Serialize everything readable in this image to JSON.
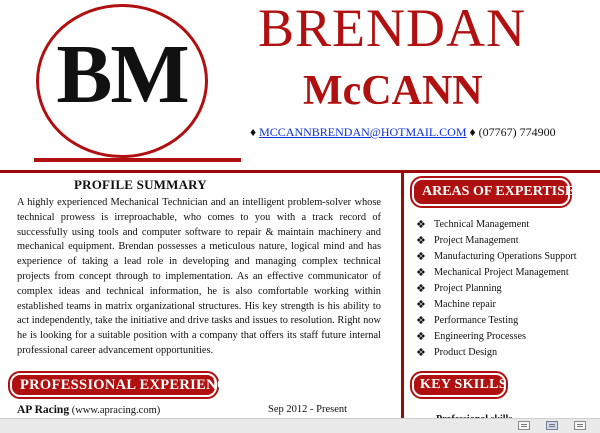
{
  "header": {
    "monogram": "BM",
    "first_name": "BRENDAN",
    "last_name": "McCANN",
    "contact": {
      "bullet": "♦",
      "email": "MCCANNBRENDAN@HOTMAIL.COM",
      "phone": "(07767) 774900"
    }
  },
  "profile": {
    "title": "PROFILE SUMMARY",
    "text": "A highly experienced Mechanical Technician and an intelligent problem-solver whose technical prowess is irreproachable, who comes to you with a track record of successfully using tools and computer software to repair & maintain machinery and mechanical equipment. Brendan possesses a meticulous nature, logical mind and has experience of taking a lead role in developing and managing complex technical projects from concept through to implementation. As an effective communicator of complex ideas and technical information, he is also comfortable working within established teams in matrix organizational structures. His key strength is his ability to act independently, take the initiative and drive tasks and issues to resolution. Right now he is looking for a suitable position with a company that offers its staff future internal professional career advancement opportunities."
  },
  "sections": {
    "areas_title": "AREAS OF EXPERTISE",
    "experience_title": "PROFESSIONAL EXPERIENCE",
    "skills_title": "KEY SKILLS"
  },
  "expertise": {
    "bullet": "❖",
    "items": [
      "Technical Management",
      "Project Management",
      "Manufacturing Operations Support",
      "Mechanical Project Management",
      "Project Planning",
      "Machine repair",
      "Performance Testing",
      "Engineering Processes",
      "Product Design"
    ]
  },
  "experience": {
    "company": "AP Racing",
    "website": "(www.apracing.com)",
    "dates": "Sep 2012 - Present"
  },
  "skills_partial": "Professional skills",
  "colors": {
    "accent": "#b01010",
    "bar": "#9a0b0b",
    "link": "#0b2fd6"
  },
  "status_icons": [
    "read-mode-icon",
    "print-layout-icon",
    "web-layout-icon"
  ]
}
